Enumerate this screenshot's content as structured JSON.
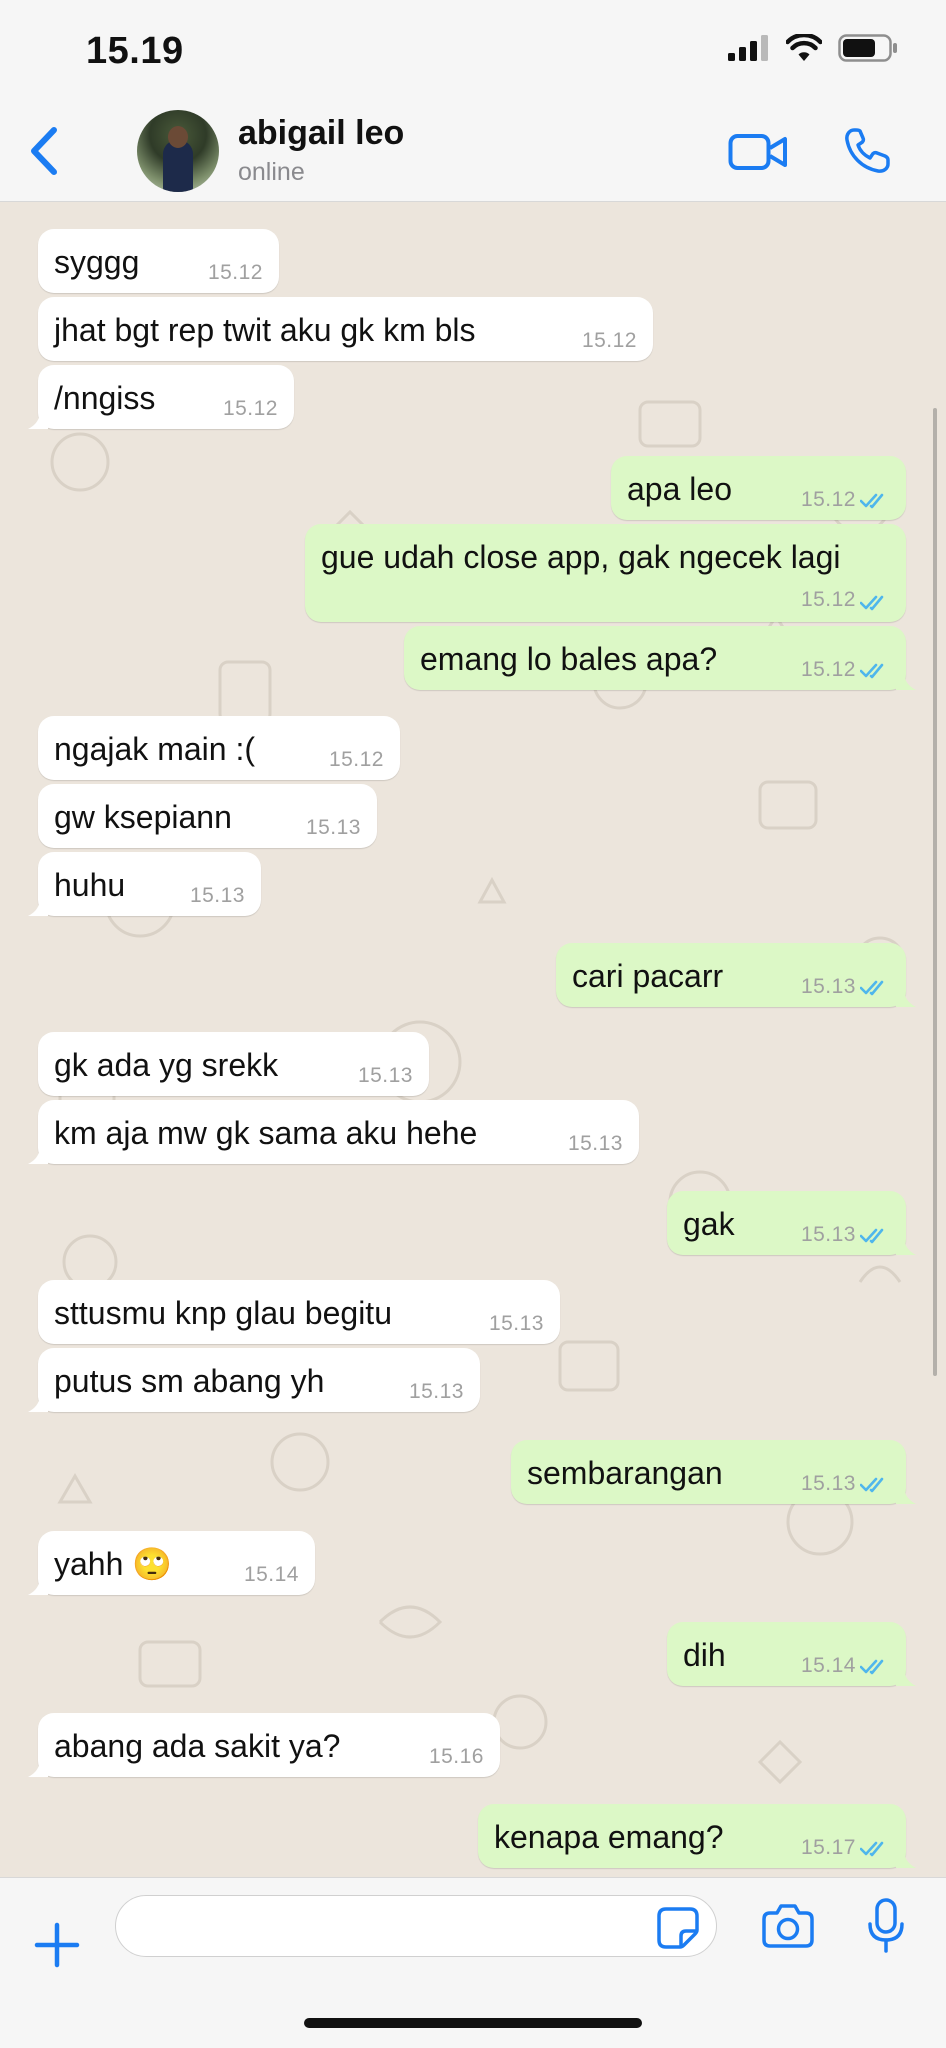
{
  "status_bar": {
    "time": "15.19"
  },
  "header": {
    "contact_name": "abigail leo",
    "contact_status": "online"
  },
  "colors": {
    "accent": "#1b7cf2",
    "incoming_bubble": "#ffffff",
    "outgoing_bubble": "#dcf8c6",
    "chat_background": "#ece5dc",
    "read_ticks": "#4fb6ec"
  },
  "messages": [
    {
      "dir": "in",
      "text": "syggg",
      "time": "15.12"
    },
    {
      "dir": "in",
      "text": "jhat bgt rep twit aku gk km bls",
      "time": "15.12"
    },
    {
      "dir": "in",
      "text": "/nngiss",
      "time": "15.12"
    },
    {
      "dir": "out",
      "text": "apa leo",
      "time": "15.12"
    },
    {
      "dir": "out",
      "text": "gue udah close app, gak ngecek lagi",
      "time": "15.12"
    },
    {
      "dir": "out",
      "text": "emang lo bales apa?",
      "time": "15.12"
    },
    {
      "dir": "in",
      "text": "ngajak main :(",
      "time": "15.12"
    },
    {
      "dir": "in",
      "text": "gw ksepiann",
      "time": "15.13"
    },
    {
      "dir": "in",
      "text": "huhu",
      "time": "15.13"
    },
    {
      "dir": "out",
      "text": "cari pacarr",
      "time": "15.13"
    },
    {
      "dir": "in",
      "text": "gk ada yg srekk",
      "time": "15.13"
    },
    {
      "dir": "in",
      "text": "km aja mw gk sama aku hehe",
      "time": "15.13"
    },
    {
      "dir": "out",
      "text": "gak",
      "time": "15.13"
    },
    {
      "dir": "in",
      "text": "sttusmu knp glau begitu",
      "time": "15.13"
    },
    {
      "dir": "in",
      "text": "putus sm abang yh",
      "time": "15.13"
    },
    {
      "dir": "out",
      "text": "sembarangan",
      "time": "15.13"
    },
    {
      "dir": "in",
      "text": "yahh 🙄",
      "time": "15.14"
    },
    {
      "dir": "out",
      "text": "dih",
      "time": "15.14"
    },
    {
      "dir": "in",
      "text": "abang ada sakit ya?",
      "time": "15.16"
    },
    {
      "dir": "out",
      "text": "kenapa emang?",
      "time": "15.17"
    }
  ],
  "input": {
    "placeholder": ""
  },
  "icons": {
    "back": "chevron-left-icon",
    "video": "video-camera-icon",
    "call": "phone-icon",
    "plus": "plus-icon",
    "sticker": "sticker-icon",
    "camera": "camera-icon",
    "mic": "microphone-icon"
  }
}
